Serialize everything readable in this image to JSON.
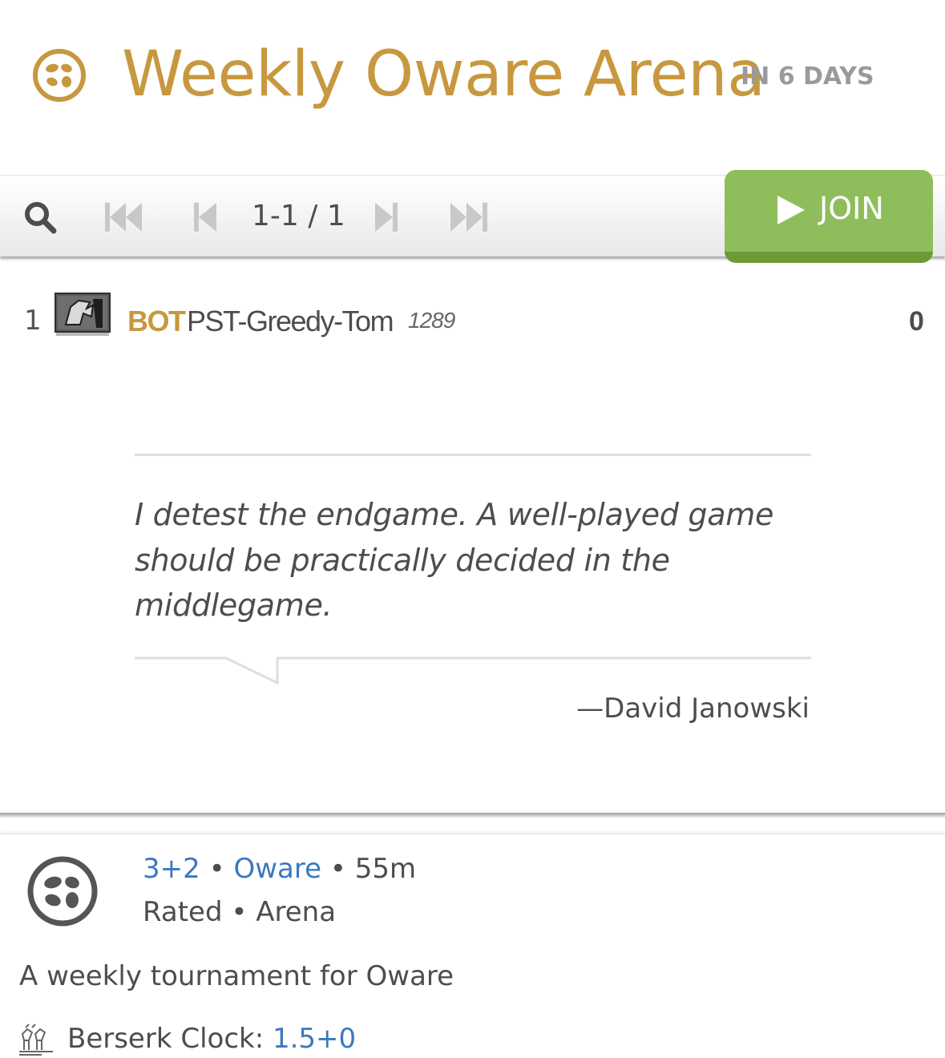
{
  "header": {
    "title": "Weekly Oware Arena",
    "starts_in": "IN 6 DAYS",
    "icon": "oware-icon",
    "brand_color": "#c7983f"
  },
  "pager": {
    "page_text": "1-1 / 1",
    "join_label": "JOIN",
    "join_color": "#8fbd5c",
    "icons": [
      "search-icon",
      "first-page-icon",
      "previous-page-icon",
      "next-page-icon",
      "last-page-icon",
      "play-icon"
    ]
  },
  "standings": [
    {
      "rank": "1",
      "title": "BOT",
      "name": "PST-Greedy-Tom",
      "rating": "1289",
      "score": "0",
      "flair": "bot-avatar-icon"
    }
  ],
  "quote": {
    "text": "I detest the endgame. A well-played game should be practically decided in the middlegame.",
    "author": "—David Janowski"
  },
  "info": {
    "clock": "3+2",
    "variant": "Oware",
    "duration": "55m",
    "rated": "Rated",
    "system": "Arena",
    "description": "A weekly tournament for Oware",
    "berserk_label": "Berserk Clock:",
    "berserk_value": "1.5+0",
    "link_color": "#3a79c1"
  }
}
